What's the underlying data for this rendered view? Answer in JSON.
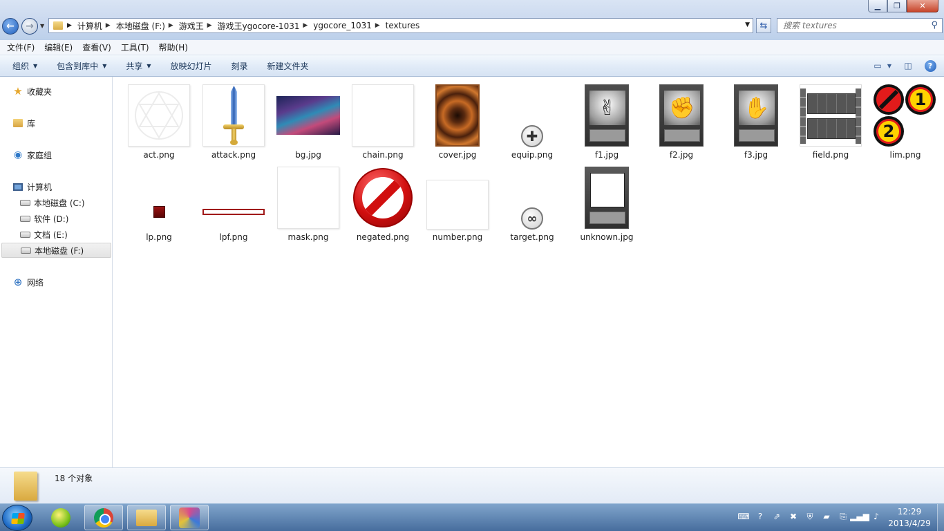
{
  "window": {
    "minimize_icon": "minimize-icon",
    "maximize_icon": "maximize-icon",
    "close_icon": "close-icon"
  },
  "address": {
    "crumbs": [
      "计算机",
      "本地磁盘 (F:)",
      "游戏王",
      "游戏王ygocore-1031",
      "ygocore_1031",
      "textures"
    ]
  },
  "search": {
    "placeholder": "搜索 textures"
  },
  "menu": {
    "items": [
      "文件(F)",
      "编辑(E)",
      "查看(V)",
      "工具(T)",
      "帮助(H)"
    ]
  },
  "toolbar": {
    "organize": "组织",
    "include_library": "包含到库中",
    "share": "共享",
    "slideshow": "放映幻灯片",
    "burn": "刻录",
    "new_folder": "新建文件夹",
    "help": "?"
  },
  "sidebar": {
    "favorites": "收藏夹",
    "libraries": "库",
    "homegroup": "家庭组",
    "computer": "计算机",
    "drive_c": "本地磁盘 (C:)",
    "drive_d": "软件 (D:)",
    "drive_e": "文档 (E:)",
    "drive_f": "本地磁盘 (F:)",
    "network": "网络"
  },
  "files": [
    {
      "name": "act.png"
    },
    {
      "name": "attack.png"
    },
    {
      "name": "bg.jpg"
    },
    {
      "name": "chain.png"
    },
    {
      "name": "cover.jpg"
    },
    {
      "name": "equip.png"
    },
    {
      "name": "f1.jpg"
    },
    {
      "name": "f2.jpg"
    },
    {
      "name": "f3.jpg"
    },
    {
      "name": "field.png"
    },
    {
      "name": "lim.png"
    },
    {
      "name": "lp.png"
    },
    {
      "name": "lpf.png"
    },
    {
      "name": "mask.png"
    },
    {
      "name": "negated.png"
    },
    {
      "name": "number.png"
    },
    {
      "name": "target.png"
    },
    {
      "name": "unknown.jpg"
    }
  ],
  "details": {
    "count": "18 个对象"
  },
  "taskbar": {
    "time": "12:29",
    "date": "2013/4/29"
  }
}
